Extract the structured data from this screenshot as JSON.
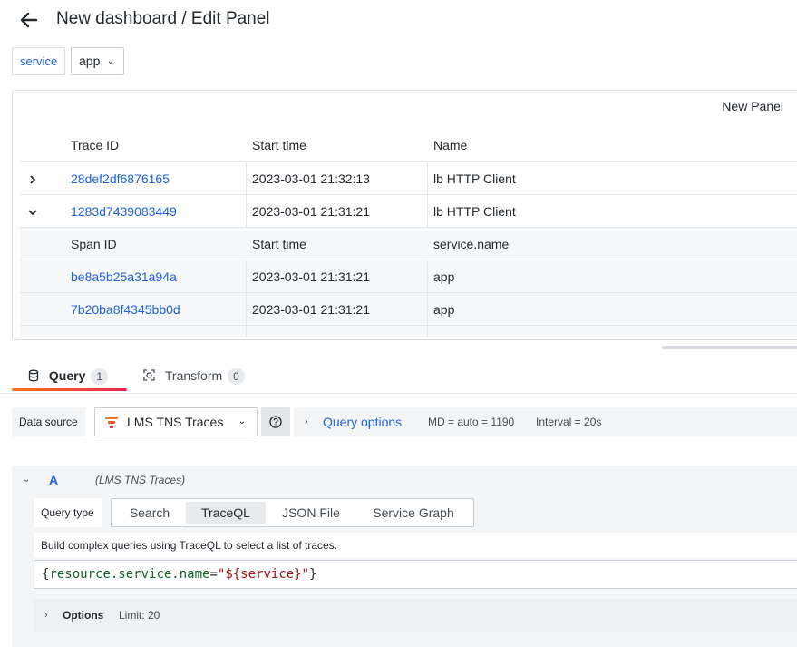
{
  "header": {
    "title": "New dashboard / Edit Panel"
  },
  "variables": {
    "label": "service",
    "value": "app"
  },
  "panel": {
    "title": "New Panel",
    "trace_columns": [
      "Trace ID",
      "Start time",
      "Name"
    ],
    "traces": [
      {
        "id": "28def2df6876165",
        "start": "2023-03-01 21:32:13",
        "name": "lb HTTP Client",
        "expanded": false
      },
      {
        "id": "1283d7439083449",
        "start": "2023-03-01 21:31:21",
        "name": "lb HTTP Client",
        "expanded": true
      }
    ],
    "span_columns": [
      "Span ID",
      "Start time",
      "service.name"
    ],
    "spans": [
      {
        "id": "be8a5b25a31a94a",
        "start": "2023-03-01 21:31:21",
        "service": "app"
      },
      {
        "id": "7b20ba8f4345bb0d",
        "start": "2023-03-01 21:31:21",
        "service": "app"
      }
    ]
  },
  "tabs": [
    {
      "label": "Query",
      "count": "1",
      "active": true
    },
    {
      "label": "Transform",
      "count": "0",
      "active": false
    }
  ],
  "datasource": {
    "label": "Data source",
    "name": "LMS TNS Traces",
    "query_options_label": "Query options",
    "md": "MD = auto = 1190",
    "interval": "Interval = 20s"
  },
  "query_a": {
    "letter": "A",
    "datasource": "(LMS TNS Traces)",
    "query_type_label": "Query type",
    "query_types": [
      "Search",
      "TraceQL",
      "JSON File",
      "Service Graph"
    ],
    "selected_type": "TraceQL",
    "help": "Build complex queries using TraceQL to select a list of traces.",
    "query": {
      "open": "{",
      "key": "resource.service.name",
      "eq": "=",
      "value": "\"${service}\"",
      "close": "}"
    },
    "options_label": "Options",
    "limit": "Limit: 20"
  },
  "colors": {
    "link": "#1f62e0",
    "tab_gradient_start": "#f7761c",
    "tab_gradient_end": "#e8264f"
  }
}
